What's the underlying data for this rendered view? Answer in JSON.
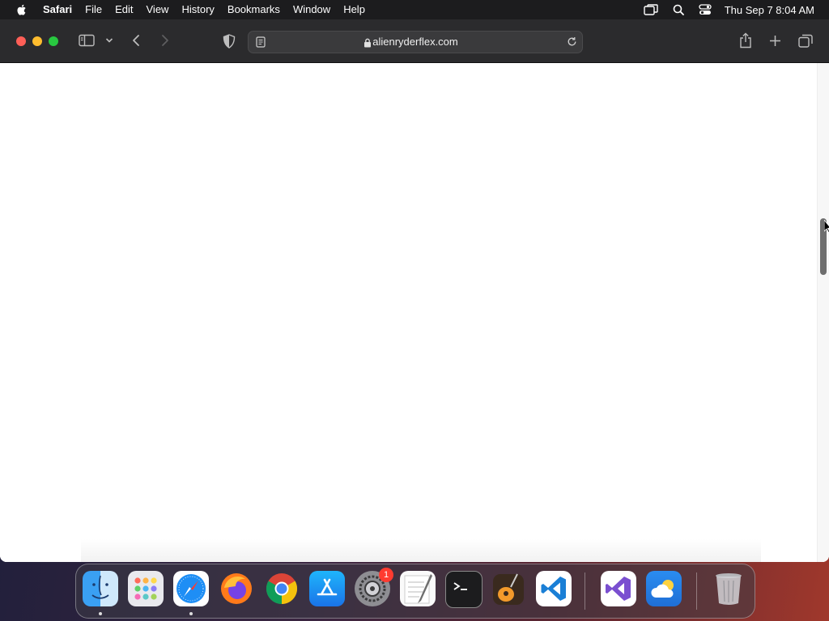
{
  "menubar": {
    "app_name": "Safari",
    "items": [
      "File",
      "Edit",
      "View",
      "History",
      "Bookmarks",
      "Window",
      "Help"
    ],
    "clock": "Thu Sep 7  8:04 AM",
    "status_icons": [
      "screen-mirroring-icon",
      "spotlight-search-icon",
      "control-center-icon"
    ]
  },
  "browser": {
    "url": "alienryderflex.com",
    "secure": true
  },
  "dock": {
    "apps": [
      {
        "name": "Finder",
        "icon": "finder-icon",
        "running": true
      },
      {
        "name": "Launchpad",
        "icon": "launchpad-icon",
        "running": false
      },
      {
        "name": "Safari",
        "icon": "safari-icon",
        "running": true
      },
      {
        "name": "Firefox",
        "icon": "firefox-icon",
        "running": false
      },
      {
        "name": "Chrome",
        "icon": "chrome-icon",
        "running": false
      },
      {
        "name": "App Store",
        "icon": "app-store-icon",
        "running": false
      },
      {
        "name": "System Settings",
        "icon": "system-settings-icon",
        "running": false,
        "badge": "1"
      },
      {
        "name": "TextEdit",
        "icon": "textedit-icon",
        "running": false
      },
      {
        "name": "Terminal",
        "icon": "terminal-icon",
        "running": false
      },
      {
        "name": "GarageBand",
        "icon": "garageband-icon",
        "running": false
      },
      {
        "name": "Visual Studio Code",
        "icon": "vscode-icon",
        "running": false
      },
      {
        "name": "Visual Studio",
        "icon": "visual-studio-icon",
        "running": false
      },
      {
        "name": "Weather",
        "icon": "weather-icon",
        "running": false
      },
      {
        "name": "Trash",
        "icon": "trash-icon",
        "running": false
      }
    ]
  },
  "colors": {
    "menubar_bg": "#1c1c1e",
    "toolbar_bg": "#2b2b2d",
    "close": "#ff5f57",
    "minimize": "#febc2e",
    "zoom": "#28c840",
    "badge": "#ff3b30"
  }
}
